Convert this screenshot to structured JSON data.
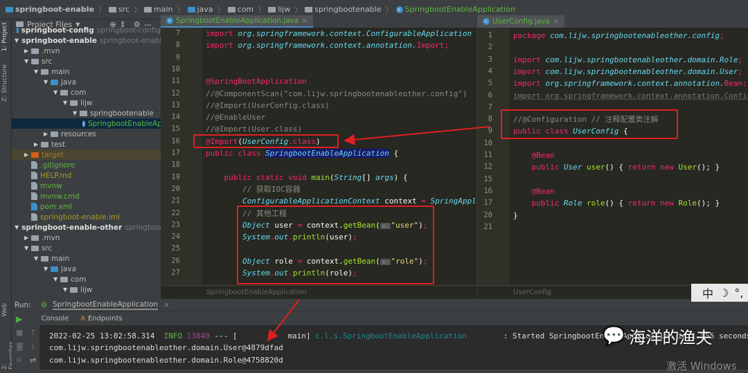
{
  "breadcrumb": [
    {
      "label": "springboot-enable",
      "icon": "module-folder-icon"
    },
    {
      "label": "src",
      "icon": "folder-icon"
    },
    {
      "label": "main",
      "icon": "folder-icon"
    },
    {
      "label": "java",
      "icon": "source-folder-icon"
    },
    {
      "label": "com",
      "icon": "package-icon"
    },
    {
      "label": "lijw",
      "icon": "package-icon"
    },
    {
      "label": "springbootenable",
      "icon": "package-icon"
    },
    {
      "label": "SpringbootEnableApplication",
      "icon": "spring-class-icon"
    }
  ],
  "side_strip": {
    "project": "1: Project",
    "structure": "Z: Structure",
    "web": "Web",
    "favorites": "2: Favorites"
  },
  "project": {
    "header": "Project Files",
    "tree": [
      {
        "label": "springboot-config",
        "secondary": "springboot-config",
        "level": 0,
        "arrow": "",
        "icon": "module",
        "bold": true
      },
      {
        "label": "springboot-enable",
        "secondary": "springboot-enable",
        "level": 0,
        "arrow": "down",
        "icon": "module",
        "bold": true
      },
      {
        "label": ".mvn",
        "level": 1,
        "arrow": "right",
        "icon": "folder"
      },
      {
        "label": "src",
        "level": 1,
        "arrow": "down",
        "icon": "folder"
      },
      {
        "label": "main",
        "level": 2,
        "arrow": "down",
        "icon": "folder"
      },
      {
        "label": "java",
        "level": 3,
        "arrow": "down",
        "icon": "srcfolder"
      },
      {
        "label": "com",
        "level": 4,
        "arrow": "down",
        "icon": "package"
      },
      {
        "label": "lijw",
        "level": 5,
        "arrow": "down",
        "icon": "package"
      },
      {
        "label": "springbootenable",
        "level": 6,
        "arrow": "down",
        "icon": "package"
      },
      {
        "label": "SpringbootEnableAp",
        "level": 7,
        "arrow": "",
        "icon": "class",
        "color": "#62b543",
        "selected": true
      },
      {
        "label": "resources",
        "level": 3,
        "arrow": "right",
        "icon": "folder"
      },
      {
        "label": "test",
        "level": 2,
        "arrow": "right",
        "icon": "folder"
      },
      {
        "label": "target",
        "level": 1,
        "arrow": "right",
        "icon": "excluded",
        "color": "#a57d3a",
        "highlight": true
      },
      {
        "label": ".gitignore",
        "level": 1,
        "arrow": "",
        "icon": "file",
        "color": "#62b543"
      },
      {
        "label": "HELP.md",
        "level": 1,
        "arrow": "",
        "icon": "file",
        "color": "#a69a2a"
      },
      {
        "label": "mvnw",
        "level": 1,
        "arrow": "",
        "icon": "file",
        "color": "#62b543"
      },
      {
        "label": "mvnw.cmd",
        "level": 1,
        "arrow": "",
        "icon": "file",
        "color": "#62b543"
      },
      {
        "label": "pom.xml",
        "level": 1,
        "arrow": "",
        "icon": "maven",
        "color": "#62b543"
      },
      {
        "label": "springboot-enable.iml",
        "level": 1,
        "arrow": "",
        "icon": "file",
        "color": "#a69a2a"
      },
      {
        "label": "springboot-enable-other",
        "secondary": "springboot-ena",
        "level": 0,
        "arrow": "down",
        "icon": "module",
        "bold": true
      },
      {
        "label": ".mvn",
        "level": 1,
        "arrow": "right",
        "icon": "folder"
      },
      {
        "label": "src",
        "level": 1,
        "arrow": "down",
        "icon": "folder"
      },
      {
        "label": "main",
        "level": 2,
        "arrow": "down",
        "icon": "folder"
      },
      {
        "label": "java",
        "level": 3,
        "arrow": "down",
        "icon": "srcfolder"
      },
      {
        "label": "com",
        "level": 4,
        "arrow": "down",
        "icon": "package"
      },
      {
        "label": "lijw",
        "level": 5,
        "arrow": "down",
        "icon": "package"
      }
    ]
  },
  "editor1": {
    "tab": "SpringbootEnableApplication.java",
    "footer": "SpringbootEnableApplication",
    "lines": [
      {
        "n": "7",
        "t": [
          [
            "import ",
            "kw"
          ],
          [
            "org.springframework.context.ConfigurableApplication",
            "pk"
          ]
        ]
      },
      {
        "n": "8",
        "t": [
          [
            "import ",
            "kw"
          ],
          [
            "org.springframework.context.annotation.",
            "pk"
          ],
          [
            "Import",
            "kw"
          ],
          [
            ";",
            "kw"
          ]
        ]
      },
      {
        "n": "9",
        "t": []
      },
      {
        "n": "10",
        "t": []
      },
      {
        "n": "11",
        "t": [
          [
            "@SpringBootApplication",
            "an"
          ]
        ]
      },
      {
        "n": "12",
        "t": [
          [
            "//@ComponentScan(\"com.lijw.springbootenableother.config\")",
            "cm"
          ]
        ]
      },
      {
        "n": "13",
        "t": [
          [
            "//@Import(UserConfig.class)",
            "cm"
          ]
        ]
      },
      {
        "n": "14",
        "t": [
          [
            "//@EnableUser",
            "cm"
          ]
        ]
      },
      {
        "n": "15",
        "t": [
          [
            "//@Import(User.class)",
            "cm"
          ]
        ]
      },
      {
        "n": "16",
        "t": [
          [
            "@Import",
            "an"
          ],
          [
            "(",
            "tx"
          ],
          [
            "UserConfig",
            "ty"
          ],
          [
            ".class",
            "an"
          ],
          [
            ")",
            "tx"
          ]
        ]
      },
      {
        "n": "17",
        "t": [
          [
            "public class ",
            "kw"
          ],
          [
            "SpringbootEnableApplication",
            "sela"
          ],
          [
            " {",
            "tx"
          ]
        ]
      },
      {
        "n": "18",
        "t": []
      },
      {
        "n": "19",
        "t": [
          [
            "    public static void ",
            "kw"
          ],
          [
            "main",
            "fn"
          ],
          [
            "(",
            "tx"
          ],
          [
            "String",
            "ty"
          ],
          [
            "[] ",
            "tx"
          ],
          [
            "args",
            "ty"
          ],
          [
            ") {",
            "tx"
          ]
        ]
      },
      {
        "n": "20",
        "t": [
          [
            "        // 获取IOC容器",
            "cm"
          ]
        ]
      },
      {
        "n": "21",
        "t": [
          [
            "        ConfigurableApplicationContext",
            "ty"
          ],
          [
            " context ",
            "tx"
          ],
          [
            "= ",
            "kw"
          ],
          [
            "SpringAppl",
            "ty"
          ]
        ]
      },
      {
        "n": "22",
        "t": [
          [
            "        // 其他工程",
            "cm"
          ]
        ]
      },
      {
        "n": "23",
        "t": [
          [
            "        Object",
            "ty"
          ],
          [
            " user ",
            "tx"
          ],
          [
            "= ",
            "kw"
          ],
          [
            "context.",
            "tx"
          ],
          [
            "getBean",
            "fn"
          ],
          [
            "(",
            "tx"
          ],
          [
            "s:",
            "hint"
          ],
          [
            "\"user\"",
            "st"
          ],
          [
            ")",
            "tx"
          ],
          [
            ";",
            "kw"
          ]
        ]
      },
      {
        "n": "24",
        "t": [
          [
            "        System",
            "ty"
          ],
          [
            ".",
            "kw"
          ],
          [
            "out",
            "ty"
          ],
          [
            ".",
            "kw"
          ],
          [
            "println",
            "fn"
          ],
          [
            "(user)",
            "tx"
          ],
          [
            ";",
            "kw"
          ]
        ]
      },
      {
        "n": "25",
        "t": []
      },
      {
        "n": "26",
        "t": [
          [
            "        Object",
            "ty"
          ],
          [
            " role ",
            "tx"
          ],
          [
            "= ",
            "kw"
          ],
          [
            "context.",
            "tx"
          ],
          [
            "getBean",
            "fn"
          ],
          [
            "(",
            "tx"
          ],
          [
            "s:",
            "hint"
          ],
          [
            "\"role\"",
            "st"
          ],
          [
            ")",
            "tx"
          ],
          [
            ";",
            "kw"
          ]
        ]
      },
      {
        "n": "27",
        "t": [
          [
            "        System",
            "ty"
          ],
          [
            ".",
            "kw"
          ],
          [
            "out",
            "ty"
          ],
          [
            ".",
            "kw"
          ],
          [
            "println",
            "fn"
          ],
          [
            "(role)",
            "tx"
          ],
          [
            ";",
            "kw"
          ]
        ]
      }
    ]
  },
  "editor2": {
    "tab": "UserConfig.java",
    "footer": "UserConfig",
    "lines": [
      {
        "n": "1",
        "t": [
          [
            "package ",
            "kw"
          ],
          [
            "com.lijw.springbootenableother.config",
            "pk"
          ],
          [
            ";",
            "kw"
          ]
        ]
      },
      {
        "n": "2",
        "t": []
      },
      {
        "n": "3",
        "t": [
          [
            "import ",
            "kw"
          ],
          [
            "com.lijw.springbootenableother.domain.Role",
            "pk"
          ],
          [
            ";",
            "kw"
          ]
        ]
      },
      {
        "n": "4",
        "t": [
          [
            "import ",
            "kw"
          ],
          [
            "com.lijw.springbootenableother.domain.User",
            "pk"
          ],
          [
            ";",
            "kw"
          ]
        ]
      },
      {
        "n": "5",
        "t": [
          [
            "import ",
            "kw"
          ],
          [
            "org.springframework.context.annotation.",
            "pk"
          ],
          [
            "Bean",
            "kw"
          ],
          [
            ";",
            "kw"
          ]
        ]
      },
      {
        "n": "6",
        "t": [
          [
            "import org.springframework.context.annotation.Configu",
            "dim"
          ]
        ]
      },
      {
        "n": "7",
        "t": []
      },
      {
        "n": "8",
        "t": [
          [
            "//@Configuration // 注释配置类注解",
            "cm"
          ]
        ]
      },
      {
        "n": "9",
        "t": [
          [
            "public class ",
            "kw"
          ],
          [
            "UserConfig",
            "ty"
          ],
          [
            " {",
            "tx"
          ]
        ]
      },
      {
        "n": "10",
        "t": []
      },
      {
        "n": "11",
        "t": [
          [
            "    @Bean",
            "an"
          ]
        ]
      },
      {
        "n": "12",
        "t": [
          [
            "    public ",
            "kw"
          ],
          [
            "User ",
            "ty"
          ],
          [
            "user",
            "fn"
          ],
          [
            "() { ",
            "tx"
          ],
          [
            "return new ",
            "kw"
          ],
          [
            "User",
            "fn"
          ],
          [
            "(); }",
            "tx"
          ]
        ]
      },
      {
        "n": "15",
        "t": []
      },
      {
        "n": "16",
        "t": [
          [
            "    @Bean",
            "an"
          ]
        ]
      },
      {
        "n": "17",
        "t": [
          [
            "    public ",
            "kw"
          ],
          [
            "Role ",
            "ty"
          ],
          [
            "role",
            "fn"
          ],
          [
            "() { ",
            "tx"
          ],
          [
            "return new ",
            "kw"
          ],
          [
            "Role",
            "fn"
          ],
          [
            "(); }",
            "tx"
          ]
        ]
      },
      {
        "n": "20",
        "t": [
          [
            "}",
            "tx"
          ]
        ]
      },
      {
        "n": "21",
        "t": []
      }
    ]
  },
  "run": {
    "label": "Run:",
    "config": "SpringbootEnableApplication",
    "tabs": [
      "Console",
      "Endpoints"
    ],
    "log": {
      "timestamp": "2022-02-25 13:02:58.314",
      "level": "INFO",
      "pid": "13840",
      "sep": "--- [",
      "thread": "           main]",
      "logger": "c.l.s.SpringbootEnableApplication",
      "message": "        : Started SpringbootEnableApplication in 1.555 seconds"
    },
    "output": [
      "com.lijw.springbootenableother.domain.User@4879dfad",
      "com.lijw.springbootenableother.domain.Role@4758820d"
    ]
  },
  "ime": {
    "mode": "中",
    "moon": "☽",
    "punct": "°,"
  },
  "watermark": "海洋的渔夫",
  "windows_notice": "激活 Windows",
  "colors": {
    "annotation_box": "#e02020",
    "editor_bg": "#272822",
    "panel_bg": "#3c3f41"
  }
}
